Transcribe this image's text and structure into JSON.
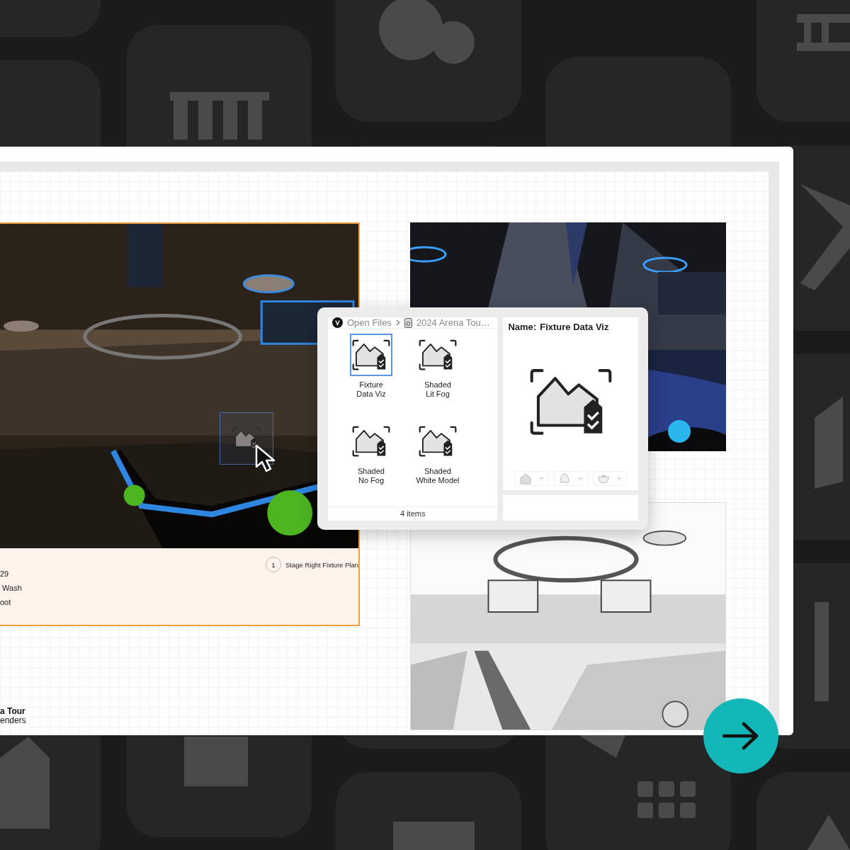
{
  "viewport": {
    "kind": "picture",
    "caption_number": "1",
    "caption": "Stage Right Fixture Plan",
    "legend": [
      "29",
      " Wash",
      "oot"
    ]
  },
  "title_block": {
    "title": "a Tour",
    "subtitle": "enders"
  },
  "file_browser": {
    "breadcrumb": [
      "Open Files",
      "2024 Arena Tou…"
    ],
    "items": [
      {
        "label": "Fixture\nData Viz",
        "selected": true
      },
      {
        "label": "Shaded\nLit Fog",
        "selected": false
      },
      {
        "label": "Shaded\nNo Fog",
        "selected": false
      },
      {
        "label": "Shaded\nWhite Model",
        "selected": false
      }
    ],
    "status": "4 items",
    "preview": {
      "name_label": "Name:",
      "name": "Fixture Data Viz"
    }
  }
}
